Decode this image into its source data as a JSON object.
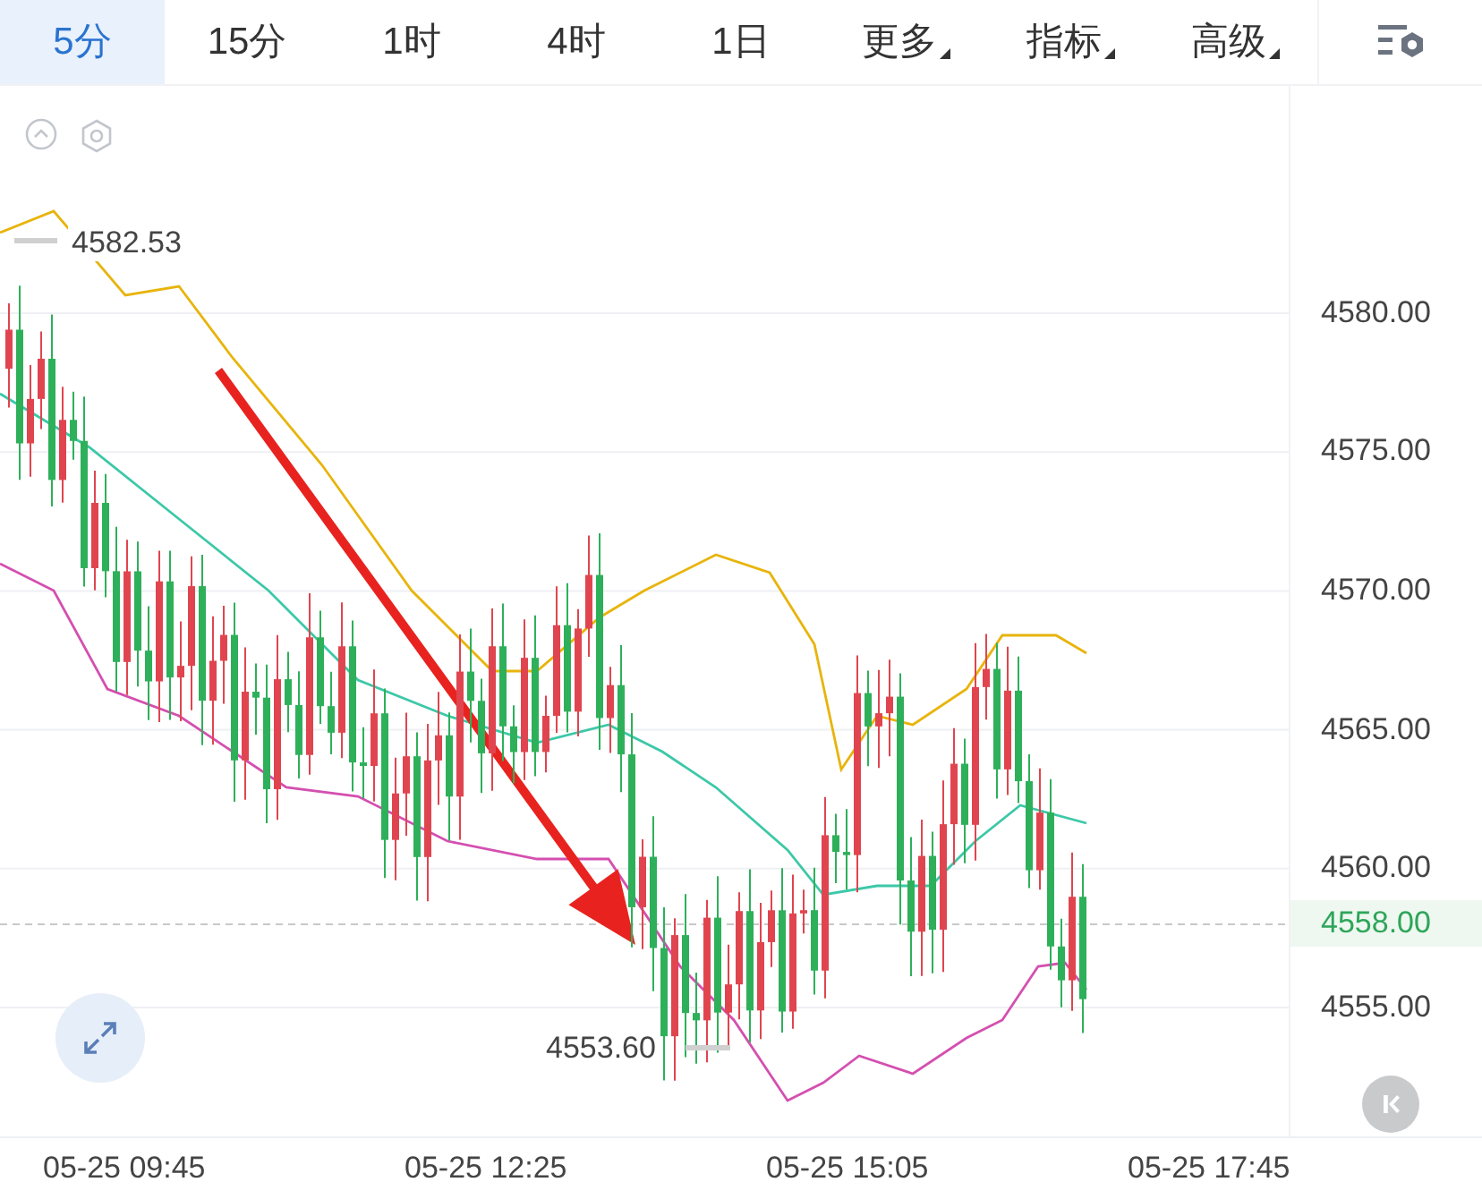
{
  "tabs": [
    {
      "label": "5分",
      "selected": true
    },
    {
      "label": "15分",
      "selected": false
    },
    {
      "label": "1时",
      "selected": false
    },
    {
      "label": "4时",
      "selected": false
    },
    {
      "label": "1日",
      "selected": false
    },
    {
      "label": "更多",
      "selected": false,
      "dropdown": true
    },
    {
      "label": "指标",
      "selected": false,
      "dropdown": true
    },
    {
      "label": "高级",
      "selected": false,
      "dropdown": true
    }
  ],
  "chart": {
    "high_label": "4582.53",
    "low_label": "4553.60",
    "price_axis": [
      "4580.00",
      "4575.00",
      "4570.00",
      "4565.00",
      "4560.00",
      "4555.00"
    ],
    "last_price": "4558.00",
    "time_axis": [
      "05-25 09:45",
      "05-25 12:25",
      "05-25 15:05",
      "05-25 17:45"
    ]
  }
}
